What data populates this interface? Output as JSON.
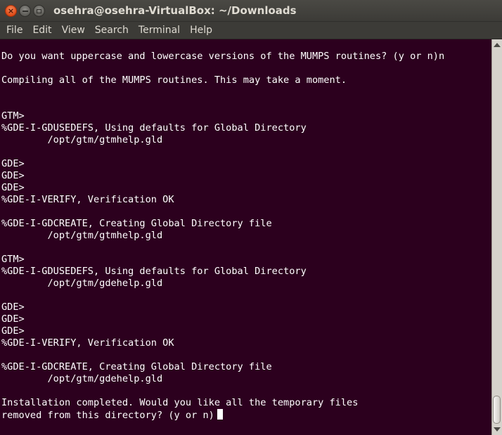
{
  "window": {
    "title": "osehra@osehra-VirtualBox: ~/Downloads",
    "close_glyph": "×",
    "min_icon": "minimize-icon",
    "max_icon": "maximize-icon"
  },
  "menubar": {
    "items": [
      "File",
      "Edit",
      "View",
      "Search",
      "Terminal",
      "Help"
    ]
  },
  "terminal": {
    "lines": [
      "Do you want uppercase and lowercase versions of the MUMPS routines? (y or n)n",
      "Compiling all of the MUMPS routines. This may take a moment.",
      "GTM>",
      "%GDE-I-GDUSEDEFS, Using defaults for Global Directory",
      "        /opt/gtm/gtmhelp.gld",
      "GDE>",
      "GDE>",
      "GDE>",
      "%GDE-I-VERIFY, Verification OK",
      "%GDE-I-GDCREATE, Creating Global Directory file",
      "        /opt/gtm/gtmhelp.gld",
      "GTM>",
      "%GDE-I-GDUSEDEFS, Using defaults for Global Directory",
      "        /opt/gtm/gdehelp.gld",
      "GDE>",
      "GDE>",
      "GDE>",
      "%GDE-I-VERIFY, Verification OK",
      "%GDE-I-GDCREATE, Creating Global Directory file",
      "        /opt/gtm/gdehelp.gld",
      "Installation completed. Would you like all the temporary files",
      "removed from this directory? (y or n)"
    ],
    "colors": {
      "background": "#2c001e",
      "foreground": "#ffffff"
    }
  },
  "theme": {
    "titlebar": "#3c3b37",
    "close_button": "#df4a16"
  }
}
